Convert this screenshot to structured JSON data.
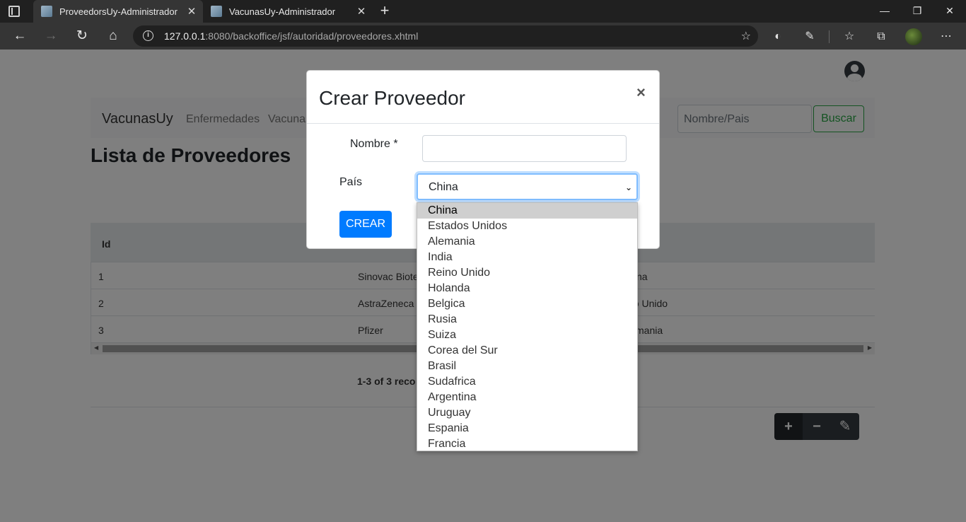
{
  "browser": {
    "tabs": [
      {
        "title": "ProveedorsUy-Administrador",
        "active": true
      },
      {
        "title": "VacunasUy-Administrador",
        "active": false
      }
    ],
    "url_host": "127.0.0.1",
    "url_rest": ":8080/backoffice/jsf/autoridad/proveedores.xhtml",
    "window_buttons": {
      "minimize": "—",
      "restore": "❐",
      "close": "✕"
    }
  },
  "navbar": {
    "brand": "VacunasUy",
    "links": [
      "Enfermedades",
      "Vacunas"
    ],
    "search_placeholder": "Nombre/Pais",
    "search_button": "Buscar"
  },
  "page": {
    "title": "Lista de Proveedores",
    "table": {
      "headers": [
        "Id"
      ],
      "rows": [
        {
          "id": "1",
          "name": "Sinovac Biote",
          "country": "na"
        },
        {
          "id": "2",
          "name": "AstraZeneca",
          "country": "no Unido"
        },
        {
          "id": "3",
          "name": "Pfizer",
          "country": "mania"
        }
      ]
    },
    "records_text": "1-3 of 3 reco",
    "actions": {
      "add": "+",
      "remove": "−",
      "edit": "✎"
    }
  },
  "modal": {
    "title": "Crear Proveedor",
    "close": "×",
    "nombre_label": "Nombre *",
    "pais_label": "País",
    "pais_selected": "China",
    "crear_button": "CREAR"
  },
  "dropdown_options": [
    "China",
    "Estados Unidos",
    "Alemania",
    "India",
    "Reino Unido",
    "Holanda",
    "Belgica",
    "Rusia",
    "Suiza",
    "Corea del Sur",
    "Brasil",
    "Sudafrica",
    "Argentina",
    "Uruguay",
    "Espania",
    "Francia"
  ]
}
